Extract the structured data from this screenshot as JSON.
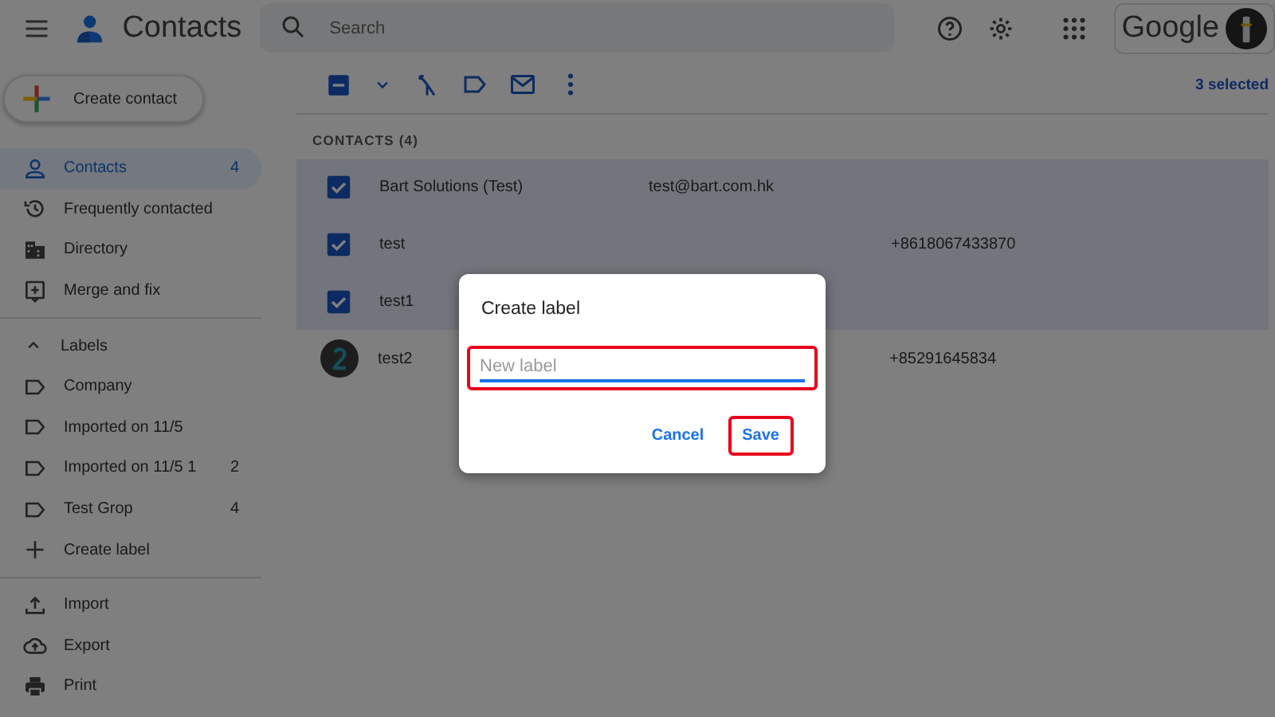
{
  "header": {
    "app_title": "Contacts",
    "search": {
      "placeholder": "Search"
    },
    "account_label": "Google"
  },
  "create_button": "Create contact",
  "sidebar": {
    "items": [
      {
        "label": "Contacts",
        "count": "4",
        "selected": true
      },
      {
        "label": "Frequently contacted",
        "selected": false
      },
      {
        "label": "Directory",
        "selected": false
      },
      {
        "label": "Merge and fix",
        "selected": false
      }
    ],
    "labels_heading": {
      "label": "Labels",
      "expanded": true
    },
    "labels": [
      {
        "kind": "label",
        "label": "Company"
      },
      {
        "kind": "label",
        "label": "Imported on 11/5"
      },
      {
        "kind": "label",
        "label": "Imported on 11/5 1",
        "count": "2"
      },
      {
        "kind": "label",
        "label": "Test Grop",
        "count": "4"
      },
      {
        "kind": "create",
        "label": "Create label"
      }
    ],
    "tools": [
      {
        "label": "Import"
      },
      {
        "label": "Export"
      },
      {
        "label": "Print"
      }
    ]
  },
  "toolbar": {
    "selection_count": "3 selected"
  },
  "list": {
    "heading": "CONTACTS (4)",
    "rows": [
      {
        "name": "Bart Solutions (Test)",
        "email": "test@bart.com.hk",
        "selected": true
      },
      {
        "name": "test",
        "phone": "+8618067433870",
        "selected": true
      },
      {
        "name": "test1",
        "selected": true
      },
      {
        "name": "test2",
        "phone": "+85291645834",
        "selected": false
      }
    ]
  },
  "dialog": {
    "title": "Create label",
    "field": {
      "placeholder": "New label",
      "highlighted": true
    },
    "buttons": [
      {
        "label": "Cancel",
        "highlighted": false
      },
      {
        "label": "Save",
        "highlighted": true
      }
    ]
  }
}
